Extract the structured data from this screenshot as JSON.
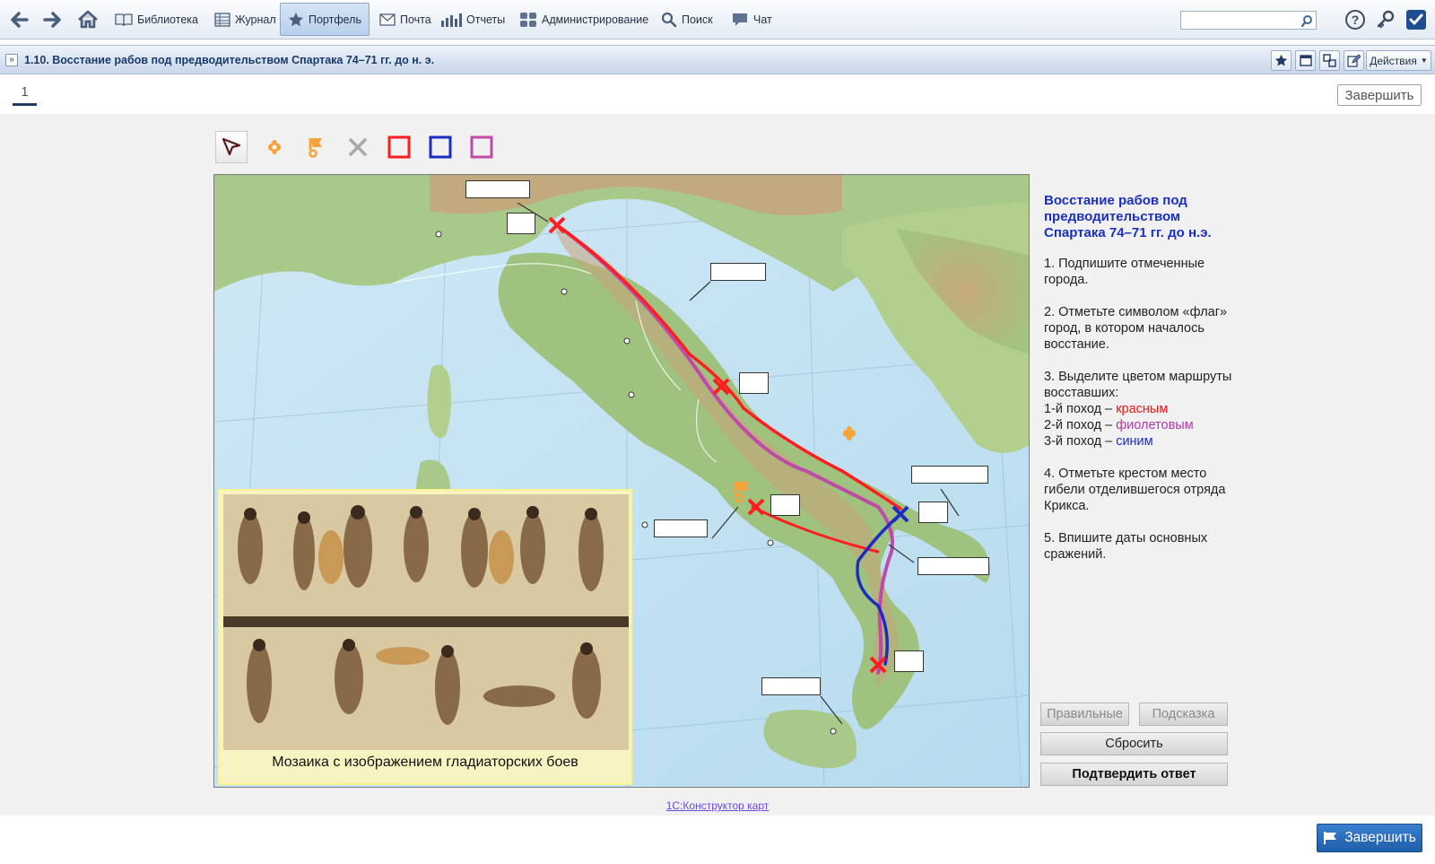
{
  "nav": {
    "items": [
      {
        "label": "Библиотека",
        "icon": "book-icon"
      },
      {
        "label": "Журнал",
        "icon": "journal-icon"
      },
      {
        "label": "Портфель",
        "icon": "star-icon"
      },
      {
        "label": "Почта",
        "icon": "mail-icon"
      },
      {
        "label": "Отчеты",
        "icon": "chart-icon"
      },
      {
        "label": "Администрирование",
        "icon": "users-icon"
      },
      {
        "label": "Поиск",
        "icon": "search-icon"
      },
      {
        "label": "Чат",
        "icon": "chat-icon"
      }
    ],
    "active_item": "Портфель",
    "search_value": ""
  },
  "titlebar": {
    "title": "1.10. Восстание рабов под предводительством Спартака 74–71 гг. до н. э.",
    "actions_label": "Действия"
  },
  "pages": {
    "current_page": "1",
    "finish_label": "Завершить"
  },
  "map": {
    "mosaic_caption": "Мозаика с изображением гладиаторских боев",
    "tools": [
      "pointer-tool",
      "marker-tool",
      "flag-tool",
      "delete-tool",
      "red-route-tool",
      "blue-route-tool",
      "violet-route-tool"
    ]
  },
  "task": {
    "title": "Восстание рабов под предводительством Спартака 74–71 гг. до н.э.",
    "step1": "1. Подпишите отмеченные города.",
    "step2": "2. Отметьте символом «флаг» город, в котором началось восстание.",
    "step3_intro": "3. Выделите цветом маршруты восставших:",
    "route1_prefix": "1-й поход – ",
    "route1_color": "красным",
    "route2_prefix": "2-й поход – ",
    "route2_color": "фиолетовым",
    "route3_prefix": "3-й поход – ",
    "route3_color": "синим",
    "step4": "4. Отметьте крестом место гибели отделившегося отряда Крикса.",
    "step5": "5. Впишите даты основных сражений."
  },
  "buttons": {
    "correct": "Правильные",
    "hint": "Подсказка",
    "reset": "Сбросить",
    "submit": "Подтвердить ответ"
  },
  "footer": {
    "link": "1С:Конструктор карт",
    "finish": "Завершить"
  },
  "colors": {
    "route1": "#ff1e1e",
    "route2": "#c04aa8",
    "route3": "#1a2fc2",
    "accent": "#1f5ea9"
  }
}
